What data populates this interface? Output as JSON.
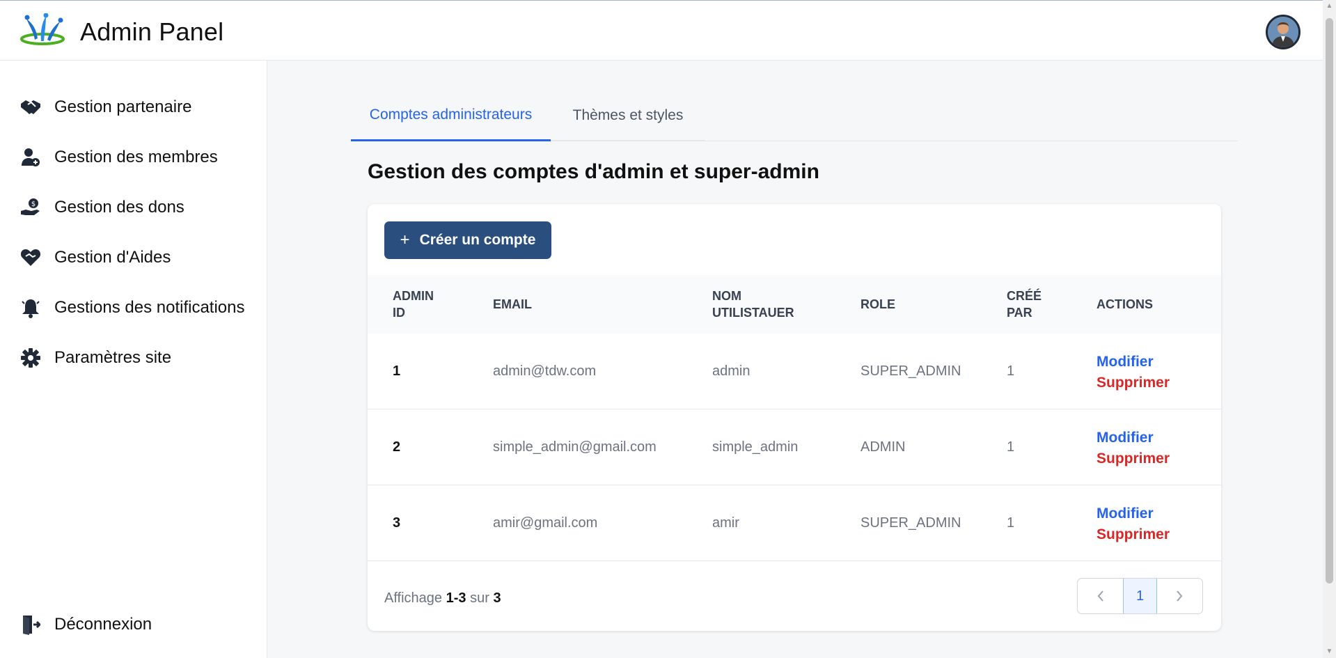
{
  "header": {
    "title": "Admin Panel"
  },
  "sidebar": {
    "items": [
      {
        "label": "Gestion partenaire",
        "icon": "handshake-icon"
      },
      {
        "label": "Gestion des membres",
        "icon": "user-plus-icon"
      },
      {
        "label": "Gestion des dons",
        "icon": "donation-hand-icon"
      },
      {
        "label": "Gestion d'Aides",
        "icon": "heart-handshake-icon"
      },
      {
        "label": "Gestions des notifications",
        "icon": "bell-icon"
      },
      {
        "label": "Paramètres site",
        "icon": "gear-icon"
      }
    ],
    "logout": {
      "label": "Déconnexion",
      "icon": "logout-door-icon"
    }
  },
  "tabs": [
    {
      "label": "Comptes administrateurs",
      "active": true
    },
    {
      "label": "Thèmes et styles",
      "active": false
    }
  ],
  "main": {
    "title": "Gestion des comptes d'admin et super-admin",
    "create_button": {
      "icon": "+",
      "label": "Créer un compte"
    }
  },
  "table": {
    "columns": [
      "ADMIN ID",
      "EMAIL",
      "NOM UTILISTAUER",
      "ROLE",
      "CRÉÉ PAR",
      "ACTIONS"
    ],
    "rows": [
      {
        "id": "1",
        "email": "admin@tdw.com",
        "username": "admin",
        "role": "SUPER_ADMIN",
        "created_by": "1",
        "edit": "Modifier",
        "delete": "Supprimer"
      },
      {
        "id": "2",
        "email": "simple_admin@gmail.com",
        "username": "simple_admin",
        "role": "ADMIN",
        "created_by": "1",
        "edit": "Modifier",
        "delete": "Supprimer"
      },
      {
        "id": "3",
        "email": "amir@gmail.com",
        "username": "amir",
        "role": "SUPER_ADMIN",
        "created_by": "1",
        "edit": "Modifier",
        "delete": "Supprimer"
      }
    ]
  },
  "pagination": {
    "prefix": "Affichage",
    "range_start": "1",
    "dash": "-",
    "range_end": "3",
    "of": "sur",
    "total": "3",
    "current_page": "1",
    "prev_icon": "‹",
    "next_icon": "›"
  },
  "colors": {
    "accent": "#2563eb",
    "primary_button": "#2a4f7e",
    "danger": "#dc2626"
  }
}
